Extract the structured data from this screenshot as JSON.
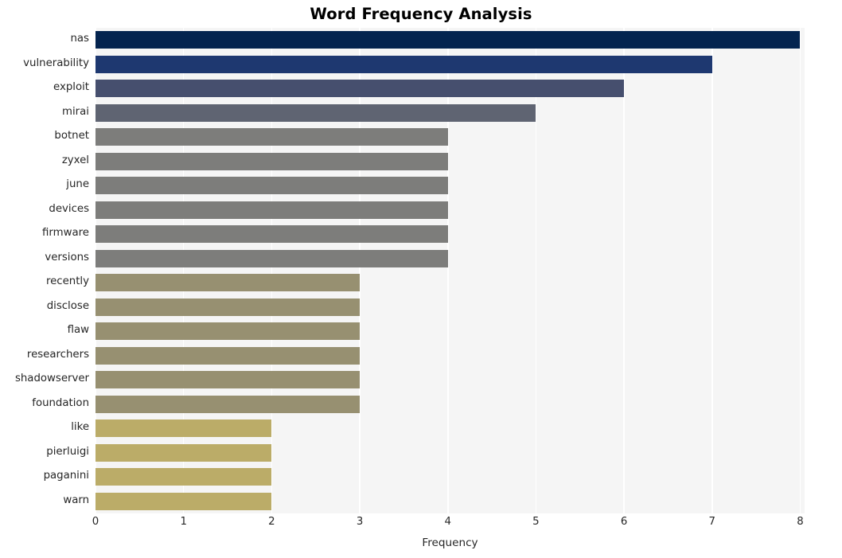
{
  "chart_data": {
    "type": "bar",
    "orientation": "horizontal",
    "title": "Word Frequency Analysis",
    "xlabel": "Frequency",
    "ylabel": "",
    "xlim": [
      0,
      8.05
    ],
    "xticks": [
      "0",
      "1",
      "2",
      "3",
      "4",
      "5",
      "6",
      "7",
      "8"
    ],
    "xtick_values": [
      0,
      1,
      2,
      3,
      4,
      5,
      6,
      7,
      8
    ],
    "grid": "vertical",
    "legend": "none",
    "categories": [
      "nas",
      "vulnerability",
      "exploit",
      "mirai",
      "botnet",
      "zyxel",
      "june",
      "devices",
      "firmware",
      "versions",
      "recently",
      "disclose",
      "flaw",
      "researchers",
      "shadowserver",
      "foundation",
      "like",
      "pierluigi",
      "paganini",
      "warn"
    ],
    "values": [
      8,
      7,
      6,
      5,
      4,
      4,
      4,
      4,
      4,
      4,
      3,
      3,
      3,
      3,
      3,
      3,
      2,
      2,
      2,
      2
    ],
    "bar_colors": [
      "#04244f",
      "#1e3870",
      "#464f6e",
      "#5f6472",
      "#7d7d7b",
      "#7d7d7b",
      "#7d7d7b",
      "#7d7d7b",
      "#7d7d7b",
      "#7d7d7b",
      "#979071",
      "#979071",
      "#979071",
      "#979071",
      "#979071",
      "#979071",
      "#bbac68",
      "#bbac68",
      "#bbac68",
      "#bbac68"
    ]
  },
  "style": {
    "plot_background": "#f5f5f5",
    "figure_background": "#ffffff",
    "gridline_color": "#ffffff",
    "text_color": "#262626",
    "title_color": "#000000"
  }
}
